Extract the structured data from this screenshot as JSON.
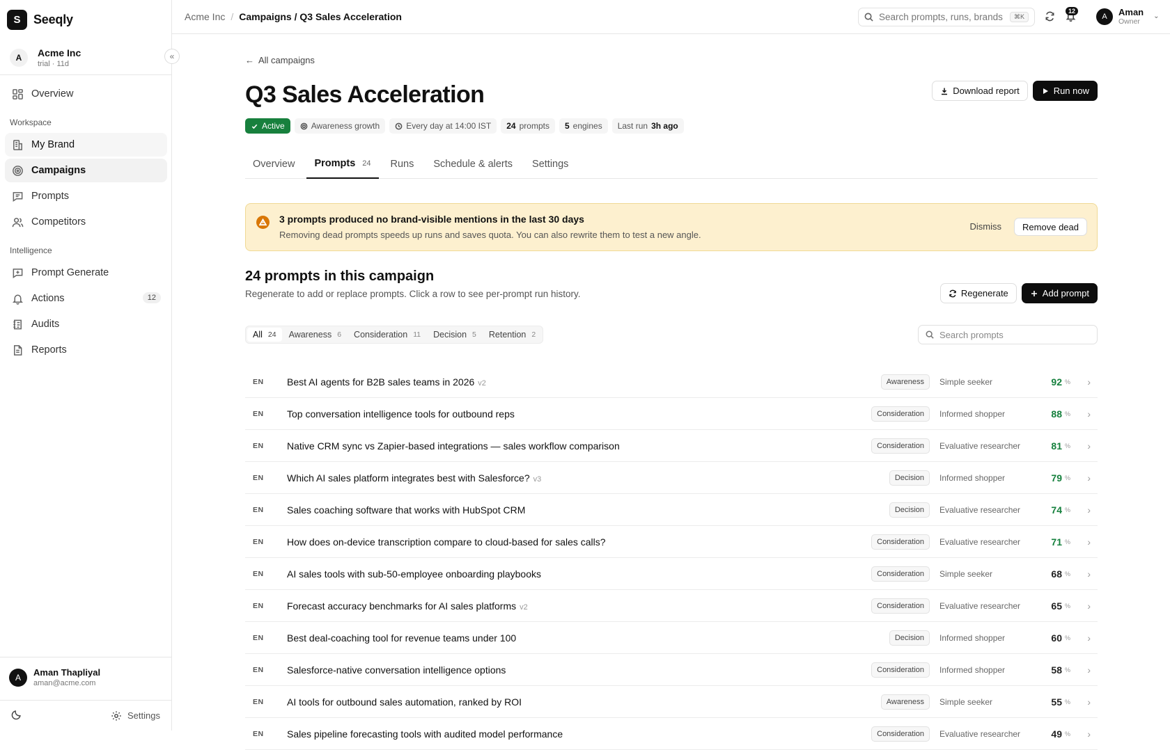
{
  "brand": {
    "name": "Seeqly",
    "logo_letter": "S"
  },
  "org": {
    "avatar": "A",
    "name": "Acme Inc",
    "sub": "trial · 11d"
  },
  "sidebar": {
    "collapse": "«",
    "top_items": [
      {
        "label": "Overview",
        "icon": "grid-icon"
      }
    ],
    "workspace_label": "Workspace",
    "workspace_items": [
      {
        "label": "My Brand",
        "icon": "building-icon"
      },
      {
        "label": "Campaigns",
        "icon": "target-icon"
      },
      {
        "label": "Prompts",
        "icon": "message-icon"
      },
      {
        "label": "Competitors",
        "icon": "users-icon"
      }
    ],
    "intelligence_label": "Intelligence",
    "intelligence_items": [
      {
        "label": "Prompt Generate",
        "icon": "message-plus-icon"
      },
      {
        "label": "Actions",
        "icon": "bell-icon",
        "count": "12"
      },
      {
        "label": "Audits",
        "icon": "list-icon"
      },
      {
        "label": "Reports",
        "icon": "file-icon"
      }
    ],
    "user": {
      "avatar": "A",
      "name": "Aman Thapliyal",
      "email": "aman@acme.com"
    },
    "settings_label": "Settings"
  },
  "topbar": {
    "crumb_root": "Acme Inc",
    "crumb_sep": "/",
    "crumb_current": "Campaigns / Q3 Sales Acceleration",
    "search_placeholder": "Search prompts, runs, brands",
    "search_kbd": "⌘K",
    "notifications": "12",
    "user_avatar": "A",
    "user_name": "Aman",
    "user_role": "Owner"
  },
  "page": {
    "back": "All campaigns",
    "title": "Q3 Sales Acceleration",
    "download_label": "Download report",
    "run_label": "Run now",
    "status": "Active",
    "goal": "Awareness growth",
    "schedule": "Every day at 14:00 IST",
    "prompts_count": "24",
    "prompts_unit": "prompts",
    "engines_count": "5",
    "engines_unit": "engines",
    "last_run_label": "Last run",
    "last_run_value": "3h ago"
  },
  "tabs": [
    {
      "label": "Overview"
    },
    {
      "label": "Prompts",
      "count": "24"
    },
    {
      "label": "Runs"
    },
    {
      "label": "Schedule & alerts"
    },
    {
      "label": "Settings"
    }
  ],
  "alert": {
    "title": "3 prompts produced no brand-visible mentions in the last 30 days",
    "sub": "Removing dead prompts speeds up runs and saves quota. You can also rewrite them to test a new angle.",
    "dismiss": "Dismiss",
    "remove": "Remove dead"
  },
  "section": {
    "title": "24 prompts in this campaign",
    "sub": "Regenerate to add or replace prompts. Click a row to see per-prompt run history.",
    "regenerate": "Regenerate",
    "add": "Add prompt"
  },
  "filters": [
    {
      "label": "All",
      "count": "24"
    },
    {
      "label": "Awareness",
      "count": "6"
    },
    {
      "label": "Consideration",
      "count": "11"
    },
    {
      "label": "Decision",
      "count": "5"
    },
    {
      "label": "Retention",
      "count": "2"
    }
  ],
  "prompt_search_placeholder": "Search prompts",
  "colors": {
    "good_score": "#15803d",
    "active": "#17803d",
    "warning": "#d97706"
  },
  "prompts": [
    {
      "lang": "EN",
      "text": "Best AI agents for B2B sales teams in 2026",
      "version": "v2",
      "stage": "Awareness",
      "persona": "Simple seeker",
      "score": "92",
      "good": true
    },
    {
      "lang": "EN",
      "text": "Top conversation intelligence tools for outbound reps",
      "version": "",
      "stage": "Consideration",
      "persona": "Informed shopper",
      "score": "88",
      "good": true
    },
    {
      "lang": "EN",
      "text": "Native CRM sync vs Zapier-based integrations — sales workflow comparison",
      "version": "",
      "stage": "Consideration",
      "persona": "Evaluative researcher",
      "score": "81",
      "good": true
    },
    {
      "lang": "EN",
      "text": "Which AI sales platform integrates best with Salesforce?",
      "version": "v3",
      "stage": "Decision",
      "persona": "Informed shopper",
      "score": "79",
      "good": true
    },
    {
      "lang": "EN",
      "text": "Sales coaching software that works with HubSpot CRM",
      "version": "",
      "stage": "Decision",
      "persona": "Evaluative researcher",
      "score": "74",
      "good": true
    },
    {
      "lang": "EN",
      "text": "How does on-device transcription compare to cloud-based for sales calls?",
      "version": "",
      "stage": "Consideration",
      "persona": "Evaluative researcher",
      "score": "71",
      "good": true
    },
    {
      "lang": "EN",
      "text": "AI sales tools with sub-50-employee onboarding playbooks",
      "version": "",
      "stage": "Consideration",
      "persona": "Simple seeker",
      "score": "68",
      "good": false
    },
    {
      "lang": "EN",
      "text": "Forecast accuracy benchmarks for AI sales platforms",
      "version": "v2",
      "stage": "Consideration",
      "persona": "Evaluative researcher",
      "score": "65",
      "good": false
    },
    {
      "lang": "EN",
      "text": "Best deal-coaching tool for revenue teams under 100",
      "version": "",
      "stage": "Decision",
      "persona": "Informed shopper",
      "score": "60",
      "good": false
    },
    {
      "lang": "EN",
      "text": "Salesforce-native conversation intelligence options",
      "version": "",
      "stage": "Consideration",
      "persona": "Informed shopper",
      "score": "58",
      "good": false
    },
    {
      "lang": "EN",
      "text": "AI tools for outbound sales automation, ranked by ROI",
      "version": "",
      "stage": "Awareness",
      "persona": "Simple seeker",
      "score": "55",
      "good": false
    },
    {
      "lang": "EN",
      "text": "Sales pipeline forecasting tools with audited model performance",
      "version": "",
      "stage": "Consideration",
      "persona": "Evaluative researcher",
      "score": "49",
      "good": false
    }
  ],
  "pct_sign": "%",
  "row_chevron": "›"
}
